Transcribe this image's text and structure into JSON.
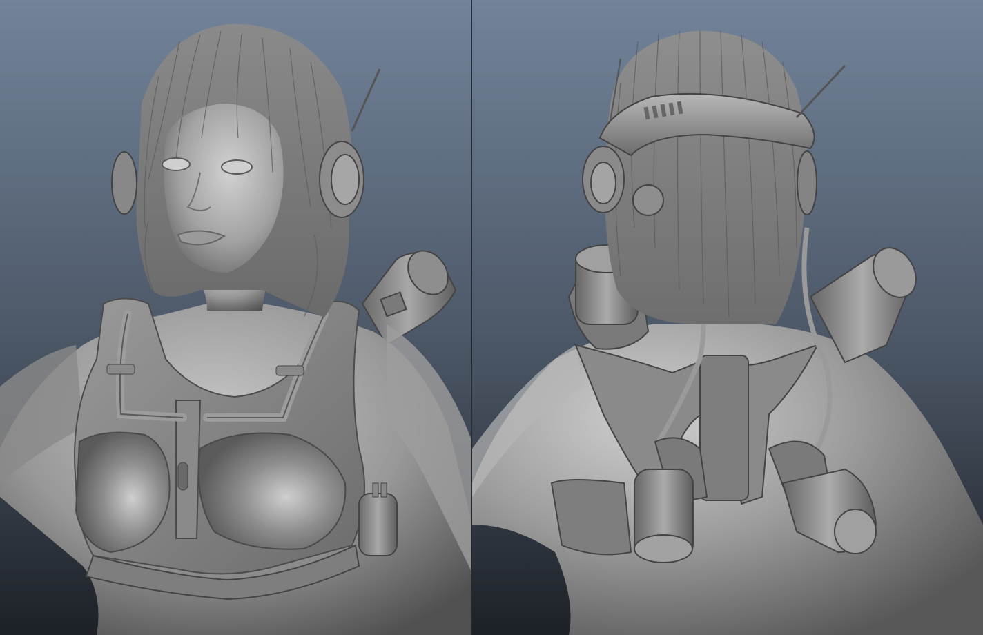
{
  "viewports": [
    {
      "id": "front",
      "view": "front-view"
    },
    {
      "id": "back",
      "view": "back-view"
    }
  ],
  "colors": {
    "bg_top": "#72839a",
    "bg_bottom": "#1d2127",
    "model_light": "#b4b4b4",
    "model_mid": "#8c8c8c",
    "model_dark": "#4a4a4a",
    "hair": "#7c7c7c",
    "divider": "#242a33"
  }
}
